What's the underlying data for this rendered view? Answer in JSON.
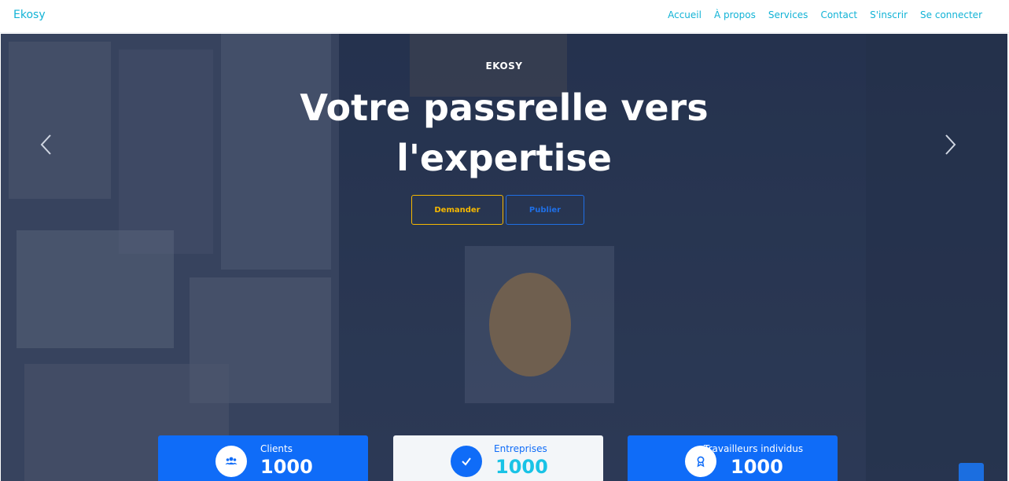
{
  "nav": {
    "brand": "Ekosy",
    "links": [
      "Accueil",
      "À propos",
      "Services",
      "Contact",
      "S'inscrir",
      "Se connecter"
    ]
  },
  "hero": {
    "eyebrow": "EKOSY",
    "headline": "Votre passrelle vers l'expertise",
    "buttons": {
      "demander": "Demander",
      "publier": "Publier"
    },
    "icons": {
      "prev": "chevron-left-icon",
      "next": "chevron-right-icon"
    }
  },
  "stats": [
    {
      "title": "Clients",
      "count": "1000",
      "icon": "users-icon"
    },
    {
      "title": "Entreprises",
      "count": "1000",
      "icon": "check-icon"
    },
    {
      "title": "Travailleurs individus",
      "count": "1000",
      "icon": "award-icon"
    }
  ],
  "colors": {
    "accent": "#12b3d6",
    "primary": "#0f6cf8",
    "warning": "#f6b800"
  }
}
